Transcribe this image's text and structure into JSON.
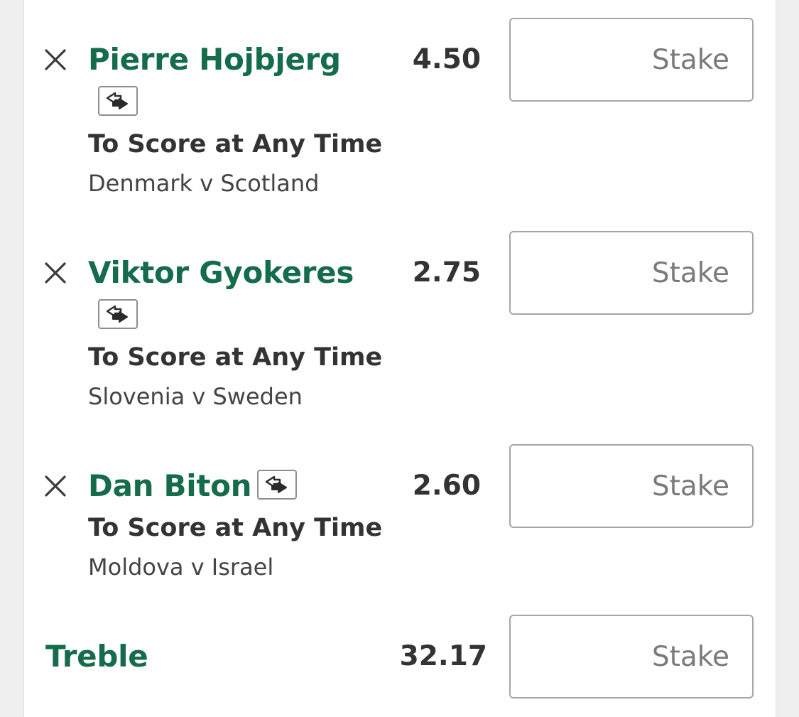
{
  "selections": [
    {
      "player": "Pierre Hojbjerg",
      "odds": "4.50",
      "market": "To Score at Any Time",
      "event": "Denmark v Scotland",
      "stake_placeholder": "Stake",
      "remove_icon": "close-icon",
      "badge_icon": "cash-out-icon"
    },
    {
      "player": "Viktor Gyokeres",
      "odds": "2.75",
      "market": "To Score at Any Time",
      "event": "Slovenia v Sweden",
      "stake_placeholder": "Stake",
      "remove_icon": "close-icon",
      "badge_icon": "cash-out-icon"
    },
    {
      "player": "Dan Biton",
      "odds": "2.60",
      "market": "To Score at Any Time",
      "event": "Moldova v Israel",
      "stake_placeholder": "Stake",
      "remove_icon": "close-icon",
      "badge_icon": "cash-out-icon"
    }
  ],
  "multiple": {
    "label": "Treble",
    "odds": "32.17",
    "stake_placeholder": "Stake"
  },
  "colors": {
    "accent_green": "#146c4b",
    "text_dark": "#333333",
    "placeholder_grey": "#7a7a7a",
    "border_grey": "#a6a6a6",
    "background": "#efefef"
  }
}
